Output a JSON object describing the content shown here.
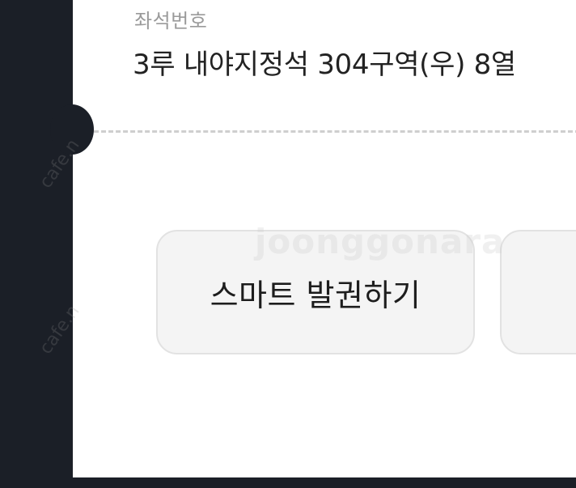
{
  "ticket": {
    "seat_label": "좌석번호",
    "seat_value": "3루 내야지정석 304구역(우) 8열"
  },
  "actions": {
    "smart_ticket_label": "스마트 발권하기"
  },
  "watermark": {
    "site_text": "cafe.n",
    "logo_text": "joonggonara"
  },
  "colors": {
    "background": "#1b1f27",
    "ticket": "#ffffff",
    "button": "#f4f4f4",
    "label_gray": "#9a9a9a",
    "text_dark": "#222222"
  }
}
